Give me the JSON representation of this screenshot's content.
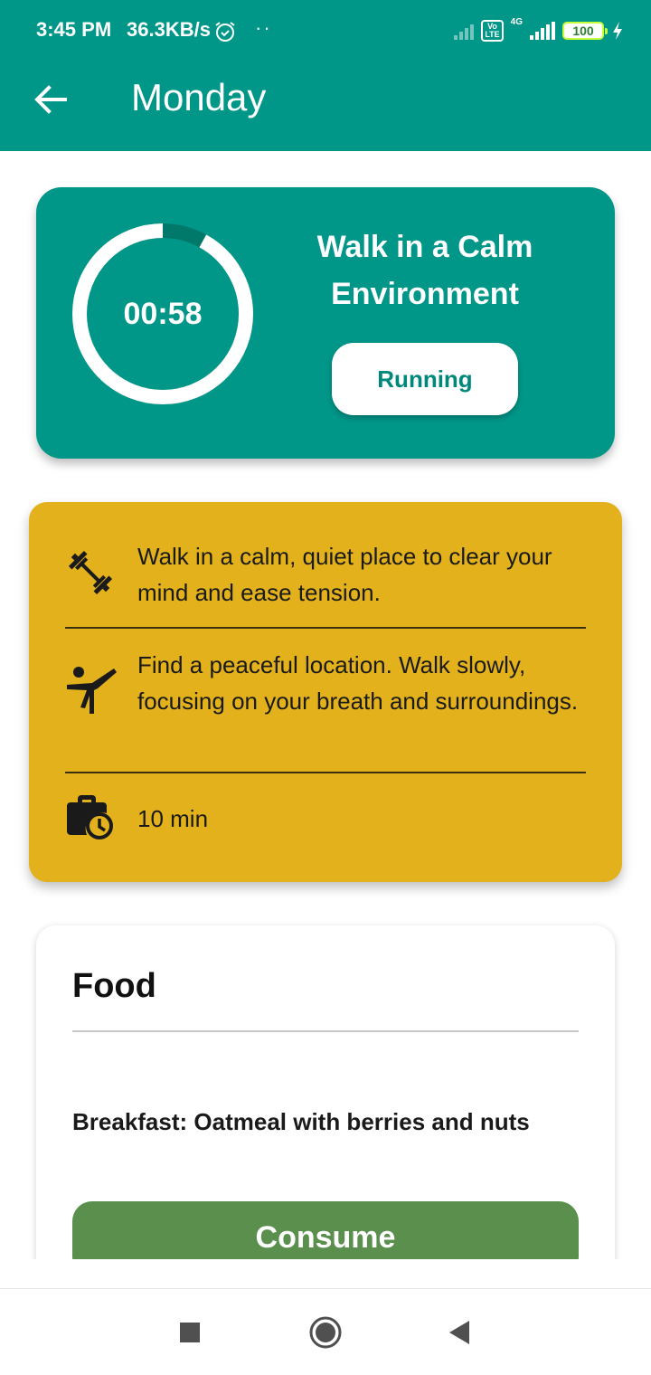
{
  "status_bar": {
    "time": "3:45 PM",
    "net_speed": "36.3KB/s",
    "volte_label": "Vo\nLTE",
    "network_type": "4G",
    "battery": "100"
  },
  "app_bar": {
    "title": "Monday",
    "back_icon": "arrow-back-icon",
    "color": "#009688"
  },
  "timer_card": {
    "time_remaining": "00:58",
    "progress_remaining": 0.92,
    "activity_title": "Walk in a Calm Environment",
    "status_button": "Running",
    "color": "#009688"
  },
  "info_card": {
    "color": "#e2b11c",
    "rows": [
      {
        "icon": "dumbbell-icon",
        "text": "Walk in a calm, quiet place to clear your mind and ease tension."
      },
      {
        "icon": "martial-arts-icon",
        "text": "Find a peaceful location. Walk slowly, focusing on your breath and surroundings."
      },
      {
        "icon": "work-history-icon",
        "text": "10 min"
      }
    ]
  },
  "food_card": {
    "title": "Food",
    "meal": "Breakfast: Oatmeal with berries and nuts",
    "button_label": "Consume",
    "button_color": "#5a8f4e"
  },
  "nav_bar": {
    "buttons": [
      "recents-icon",
      "home-icon",
      "back-triangle-icon"
    ]
  }
}
